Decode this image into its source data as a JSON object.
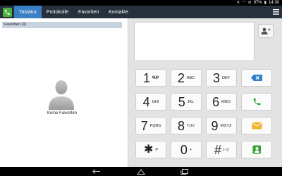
{
  "status_bar": {
    "battery": "97%",
    "time": "14:30"
  },
  "tabs": [
    {
      "label": "Tastatur",
      "active": true
    },
    {
      "label": "Protokolle",
      "active": false
    },
    {
      "label": "Favoriten",
      "active": false
    },
    {
      "label": "Kontakte",
      "active": false
    }
  ],
  "favorites": {
    "header": "Favoriten (0)",
    "empty_text": "Keine Favoriten"
  },
  "dialer": {
    "number_value": "",
    "keys": [
      {
        "digit": "1",
        "letters": "QO"
      },
      {
        "digit": "2",
        "letters": "ABC"
      },
      {
        "digit": "3",
        "letters": "DEF"
      },
      {
        "digit": "4",
        "letters": "GHI"
      },
      {
        "digit": "5",
        "letters": "JKL"
      },
      {
        "digit": "6",
        "letters": "MNO"
      },
      {
        "digit": "7",
        "letters": "PQRS"
      },
      {
        "digit": "8",
        "letters": "TUV"
      },
      {
        "digit": "9",
        "letters": "WXYZ"
      },
      {
        "digit": "✱",
        "letters": "P"
      },
      {
        "digit": "0",
        "letters": "+"
      },
      {
        "digit": "#",
        "letters": "|◁|"
      }
    ]
  },
  "colors": {
    "tab_bar": "#27313d",
    "active_tab": "#3b7fc4",
    "call_green": "#3aa23a",
    "delete_blue": "#2f7fc8",
    "message_yellow": "#f0b429"
  }
}
